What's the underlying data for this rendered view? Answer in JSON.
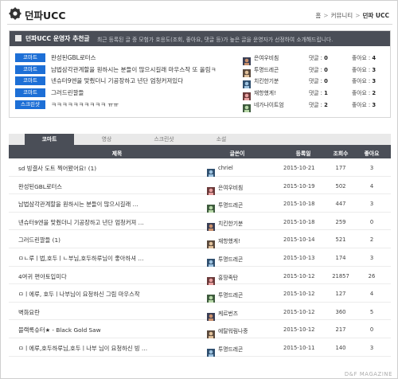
{
  "header": {
    "title": "던파UCC",
    "logo_icon": "gear-icon",
    "breadcrumb": [
      "홈",
      "커뮤니티",
      "던파 UCC"
    ]
  },
  "recommend": {
    "title": "던파UCC 운영자 추천글",
    "description": "최근 등록된 글 중 모험가 호응도(조회, 좋아요, 댓글 등)가 높은 글을 운영자가 선정하여 소개해드립니다.",
    "comment_label": "댓글 : ",
    "like_label": "좋아요 : ",
    "badge_color": "#1d6fd6",
    "items": [
      {
        "category": "코마트",
        "subject": "완성된GBL로터스",
        "nick": "은여우비침",
        "comments": "0",
        "likes": "4"
      },
      {
        "category": "코마트",
        "subject": "남법삼각관계할을 원하시는 분들이 많으시길래 마우스작 또 올림ㅋ",
        "nick": "투명드레곤",
        "comments": "0",
        "likes": "3"
      },
      {
        "category": "코마트",
        "subject": "넨슈터9엔을 맞췄더니 기공장하고 년단 엄청커져있다",
        "nick": "치킨한기분",
        "comments": "0",
        "likes": "3"
      },
      {
        "category": "코마트",
        "subject": "그러드린깔들",
        "nick": "재항했게!",
        "comments": "1",
        "likes": "2"
      },
      {
        "category": "스크린샷",
        "subject": "ㅋㅋㅋㅋㅋㅋㅋㅋㅋㅋ ㅠㅠ",
        "nick": "네가나이트엄",
        "comments": "2",
        "likes": "3"
      }
    ]
  },
  "tabs": [
    {
      "label": "코마트",
      "active": true
    },
    {
      "label": "영상",
      "active": false
    },
    {
      "label": "스크린샷",
      "active": false
    },
    {
      "label": "소설",
      "active": false
    }
  ],
  "table": {
    "headers": [
      "제목",
      "글쓴이",
      "등록일",
      "조회수",
      "좋아요"
    ],
    "rows": [
      {
        "subject": "sd 빙결사 도트 찍어봤어요! (1)",
        "nick": "chriel",
        "date": "2015-10-21",
        "views": "177",
        "likes": "3"
      },
      {
        "subject": "완성된GBL로터스",
        "nick": "은여우비침",
        "date": "2015-10-19",
        "views": "502",
        "likes": "4"
      },
      {
        "subject": "남법삼각관계할을 원하시는 분들이 많으시길래 …",
        "nick": "투명드레곤",
        "date": "2015-10-18",
        "views": "447",
        "likes": "3"
      },
      {
        "subject": "넨슈터9엔을 맞췄더니 기공장하고 년단 엄청커져 …",
        "nick": "치킨한기분",
        "date": "2015-10-18",
        "views": "259",
        "likes": "0"
      },
      {
        "subject": "그러드린깔들 (1)",
        "nick": "재항했게!",
        "date": "2015-10-14",
        "views": "521",
        "likes": "2"
      },
      {
        "subject": "ㅁㄴ루ㅣ법,호두ㅣㄴ부님,호두하루님이 좋아하셔 …",
        "nick": "투명드레곤",
        "date": "2015-10-13",
        "views": "174",
        "likes": "3"
      },
      {
        "subject": "4여귀 편야토입미다",
        "nick": "홍땅족탄",
        "date": "2015-10-12",
        "views": "21857",
        "likes": "26"
      },
      {
        "subject": "ㅁㅣ에루, 호두ㅣ나부님이 요청하신 그림 마우스작",
        "nick": "투명드레곤",
        "date": "2015-10-12",
        "views": "127",
        "likes": "4"
      },
      {
        "subject": "벽화요란",
        "nick": "케르번즈",
        "date": "2015-10-12",
        "views": "360",
        "likes": "5"
      },
      {
        "subject": "블랙록슈터★ - Black Gold Saw",
        "nick": "에탈워림나중",
        "date": "2015-10-12",
        "views": "217",
        "likes": "0"
      },
      {
        "subject": "ㅁㅣ에루,호두하루님,호두ㅣ나부 님이 요청하신 빙 …",
        "nick": "투명드레곤",
        "date": "2015-10-11",
        "views": "140",
        "likes": "3"
      }
    ]
  },
  "footer": {
    "watermark": "D&F MAGAZINE"
  }
}
